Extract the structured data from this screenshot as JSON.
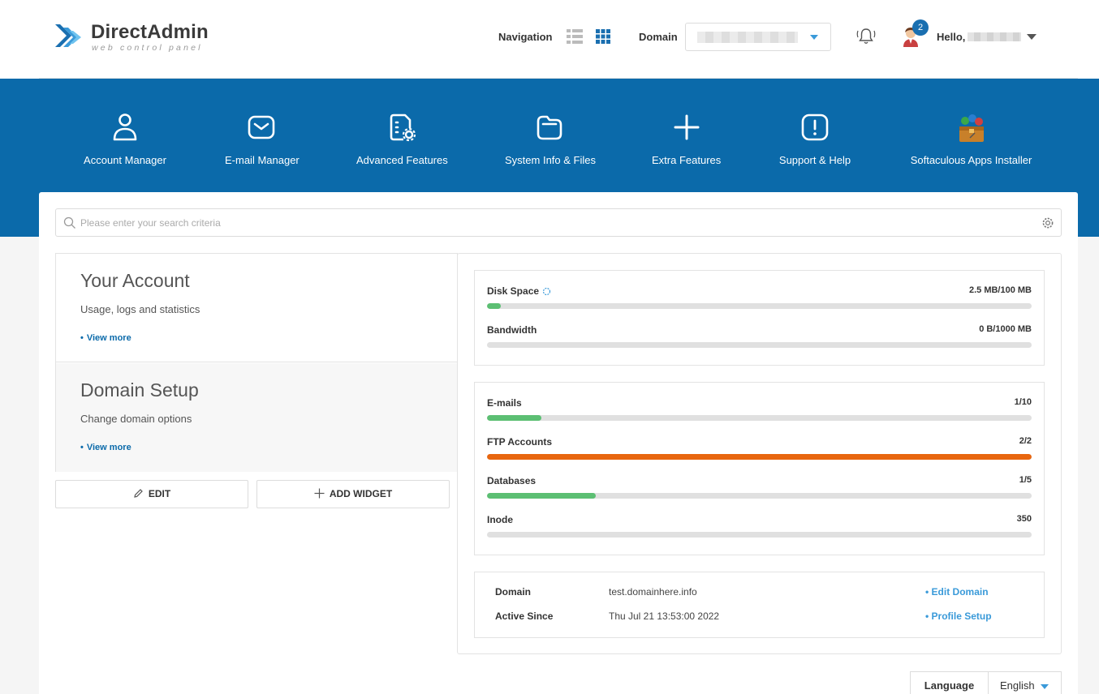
{
  "header": {
    "logo_title": "DirectAdmin",
    "logo_subtitle": "web control panel",
    "navigation_label": "Navigation",
    "domain_label": "Domain",
    "notification_count": "2",
    "hello_label": "Hello,"
  },
  "menu": [
    {
      "label": "Account Manager",
      "icon": "user-icon"
    },
    {
      "label": "E-mail Manager",
      "icon": "envelope-icon"
    },
    {
      "label": "Advanced Features",
      "icon": "document-gear-icon"
    },
    {
      "label": "System Info & Files",
      "icon": "folder-icon"
    },
    {
      "label": "Extra Features",
      "icon": "plus-icon"
    },
    {
      "label": "Support & Help",
      "icon": "exclamation-icon"
    },
    {
      "label": "Softaculous Apps Installer",
      "icon": "softaculous-icon"
    }
  ],
  "search": {
    "placeholder": "Please enter your search criteria"
  },
  "cards": [
    {
      "title": "Your Account",
      "subtitle": "Usage, logs and statistics",
      "link": "View more"
    },
    {
      "title": "Domain Setup",
      "subtitle": "Change domain options",
      "link": "View more"
    }
  ],
  "buttons": {
    "edit": "EDIT",
    "add_widget": "ADD WIDGET"
  },
  "usage": [
    {
      "name": "Disk Space",
      "value": "2.5 MB/100 MB",
      "percent": 2.5,
      "color": "#5cbf73"
    },
    {
      "name": "Bandwidth",
      "value": "0 B/1000 MB",
      "percent": 0,
      "color": "#5cbf73"
    }
  ],
  "limits": [
    {
      "name": "E-mails",
      "value": "1/10",
      "percent": 10,
      "color": "#5cbf73"
    },
    {
      "name": "FTP Accounts",
      "value": "2/2",
      "percent": 100,
      "color": "#e8660f"
    },
    {
      "name": "Databases",
      "value": "1/5",
      "percent": 20,
      "color": "#5cbf73"
    },
    {
      "name": "Inode",
      "value": "350",
      "percent": 0,
      "color": "#5cbf73"
    }
  ],
  "domain_info": {
    "domain_label": "Domain",
    "domain_value": "test.domainhere.info",
    "edit_link": "Edit Domain",
    "active_label": "Active Since",
    "active_value": "Thu Jul 21 13:53:00 2022",
    "profile_link": "Profile Setup"
  },
  "language": {
    "label": "Language",
    "value": "English"
  },
  "colors": {
    "brand_blue": "#0b6aaa",
    "accent_blue": "#3a9ad9",
    "ok_green": "#5cbf73",
    "warn_orange": "#e8660f"
  }
}
